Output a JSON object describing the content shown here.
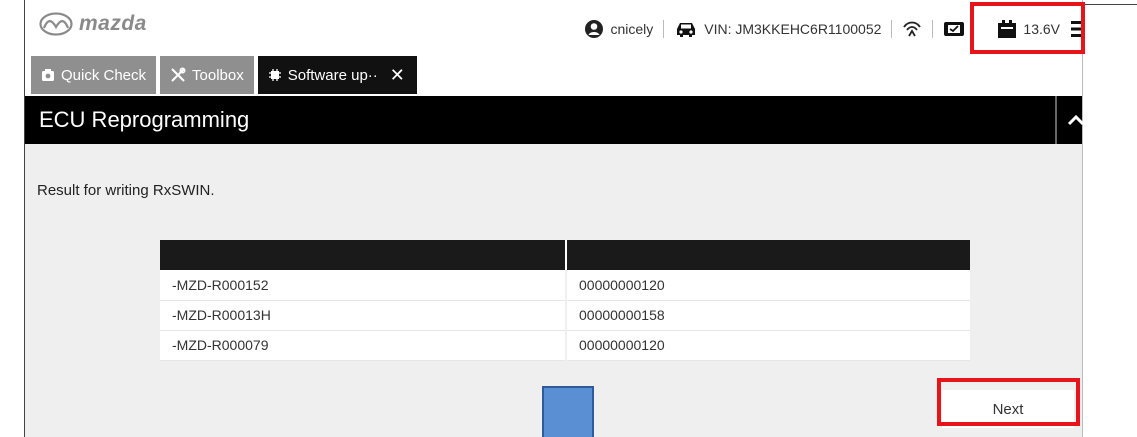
{
  "header": {
    "logo_text": "mazda",
    "user": "cnicely",
    "vin_label": "VIN: JM3KKEHC6R1100052",
    "battery_voltage": "13.6V"
  },
  "tabs": [
    {
      "label": "Quick Check",
      "icon": "camera-icon",
      "active": false
    },
    {
      "label": "Toolbox",
      "icon": "tools-icon",
      "active": false
    },
    {
      "label": "Software up··",
      "icon": "chip-icon",
      "active": true,
      "close": "✕"
    }
  ],
  "page": {
    "title": "ECU Reprogramming",
    "result_text": "Result for writing RxSWIN."
  },
  "table": {
    "headers": [
      "",
      ""
    ],
    "rows": [
      [
        "-MZD-R000152",
        "00000000120"
      ],
      [
        "-MZD-R00013H",
        "00000000158"
      ],
      [
        "-MZD-R000079",
        "00000000120"
      ]
    ]
  },
  "actions": {
    "next_label": "Next"
  },
  "colors": {
    "highlight": "#e8141b",
    "tab_inactive": "#8f8f8f",
    "tab_active": "#111111",
    "content_bg": "#efefef",
    "overlay_blue": "#5b8fd4"
  }
}
